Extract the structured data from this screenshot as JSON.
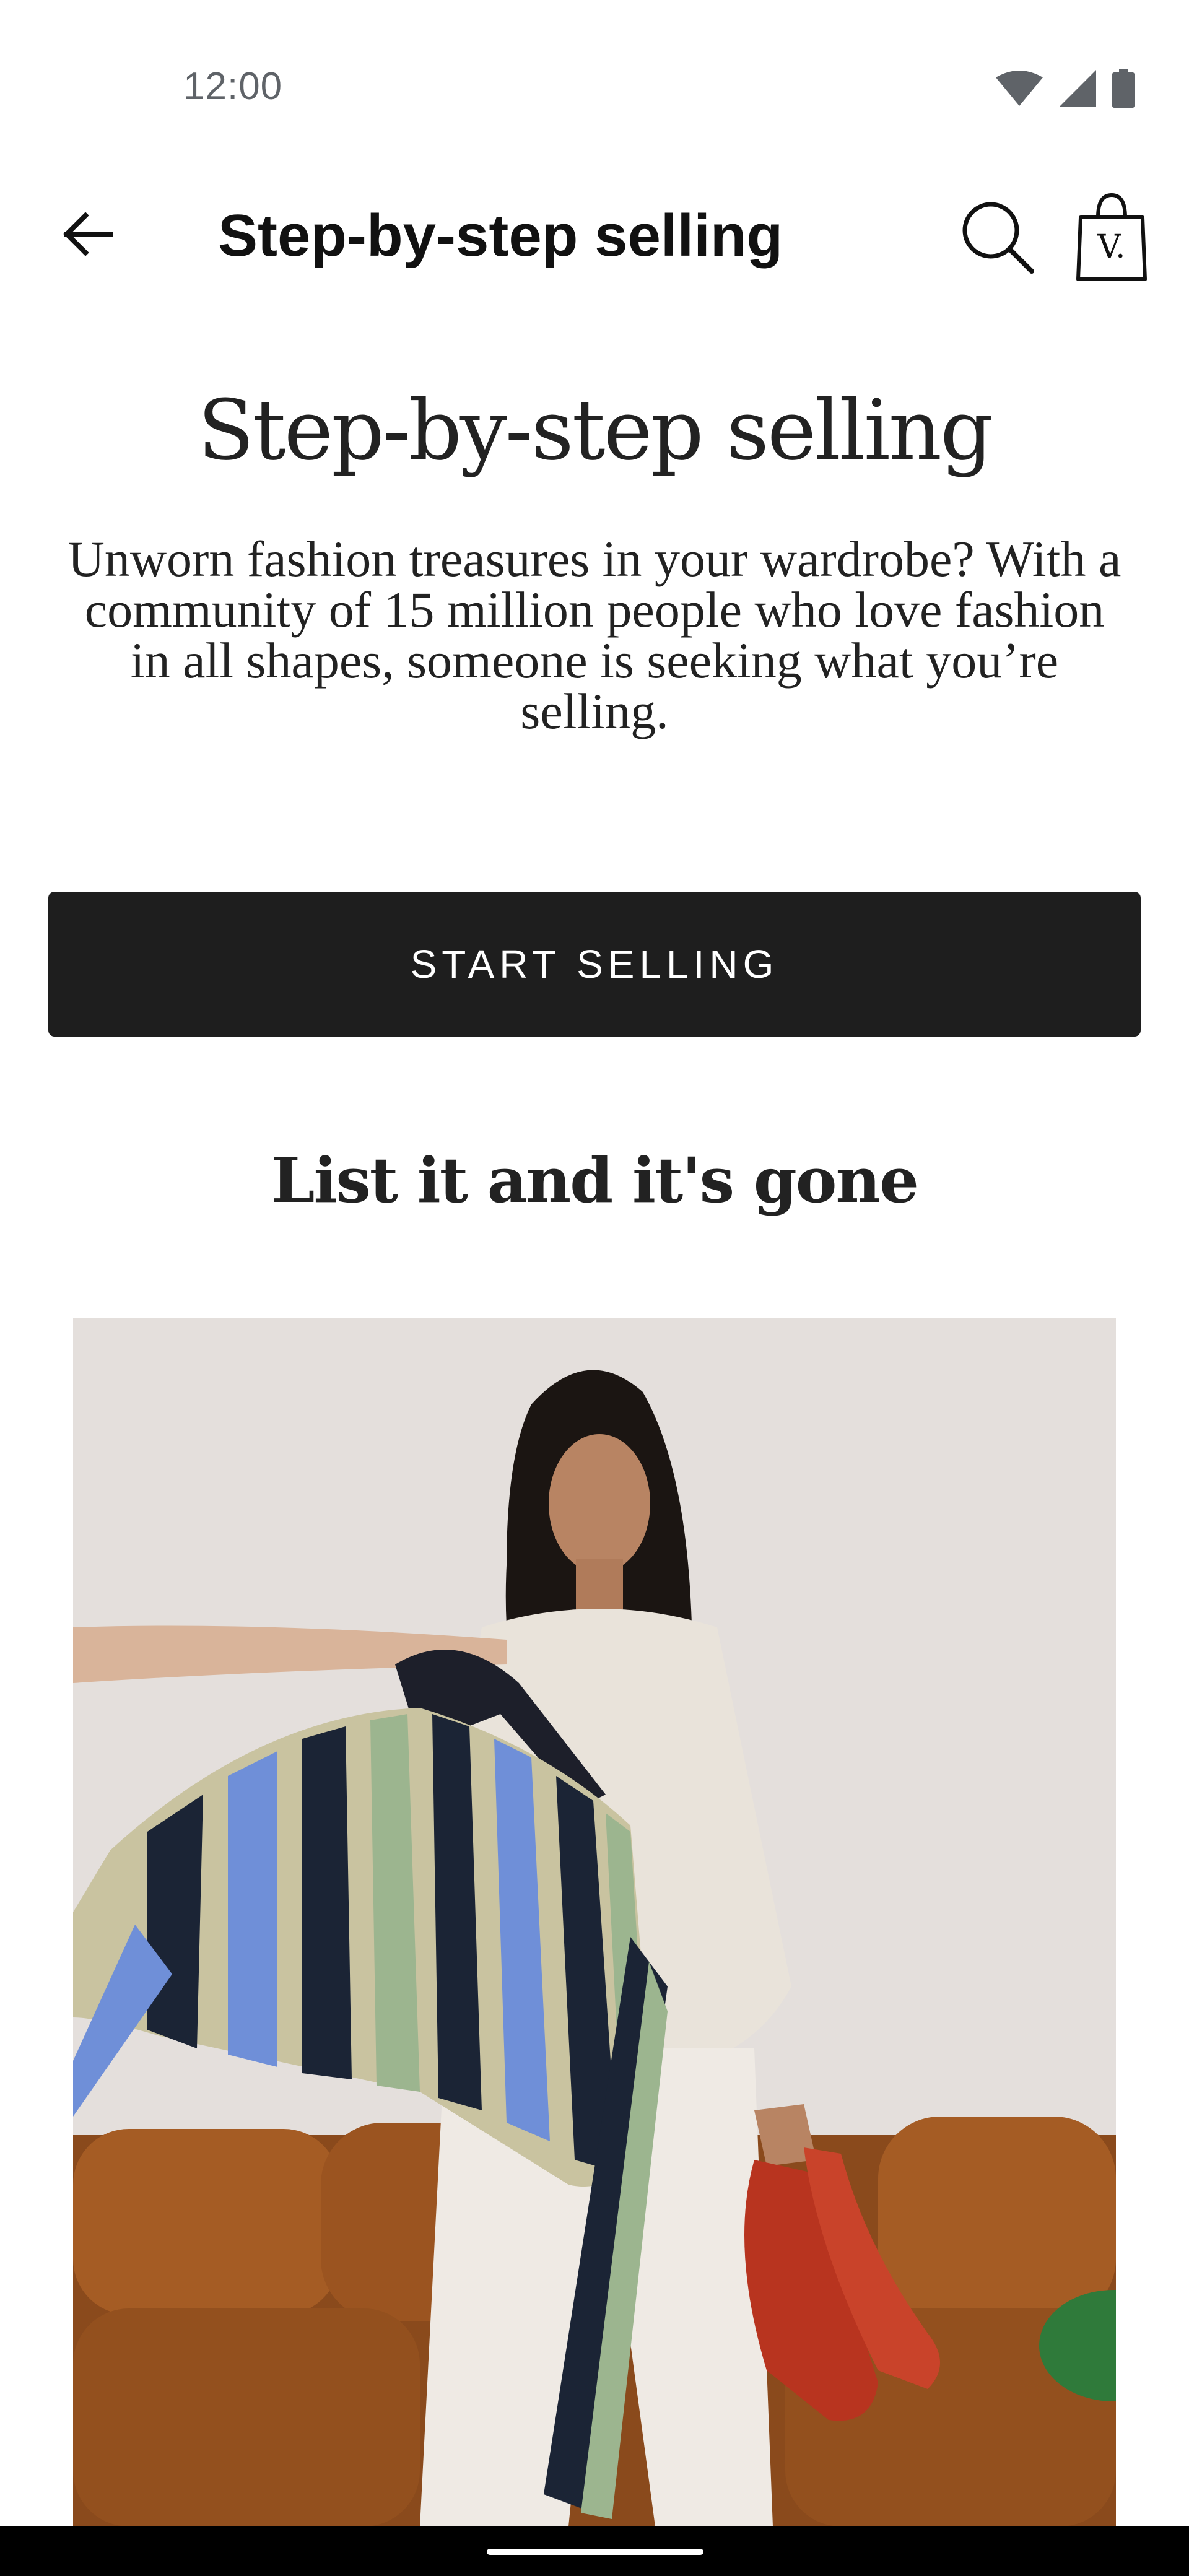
{
  "status_bar": {
    "time": "12:00",
    "icons": [
      "wifi-icon",
      "cellular-signal-icon",
      "battery-icon"
    ]
  },
  "app_bar": {
    "back_icon": "arrow-left-icon",
    "title": "Step-by-step selling",
    "search_icon": "search-icon",
    "bag_icon": "shopping-bag-icon",
    "bag_logo_letter": "V."
  },
  "hero": {
    "title": "Step-by-step selling",
    "description": "Unworn fashion treasures in your wardrobe? With a community of 15 million people who love fashion in all shapes, someone is seeking what you’re selling."
  },
  "cta": {
    "label": "START SELLING"
  },
  "section": {
    "title": "List it and it's gone"
  },
  "colors": {
    "button_background": "#1e1e1e",
    "text_primary": "#222222",
    "status_text": "#5f6368",
    "nav_bar": "#000000"
  }
}
